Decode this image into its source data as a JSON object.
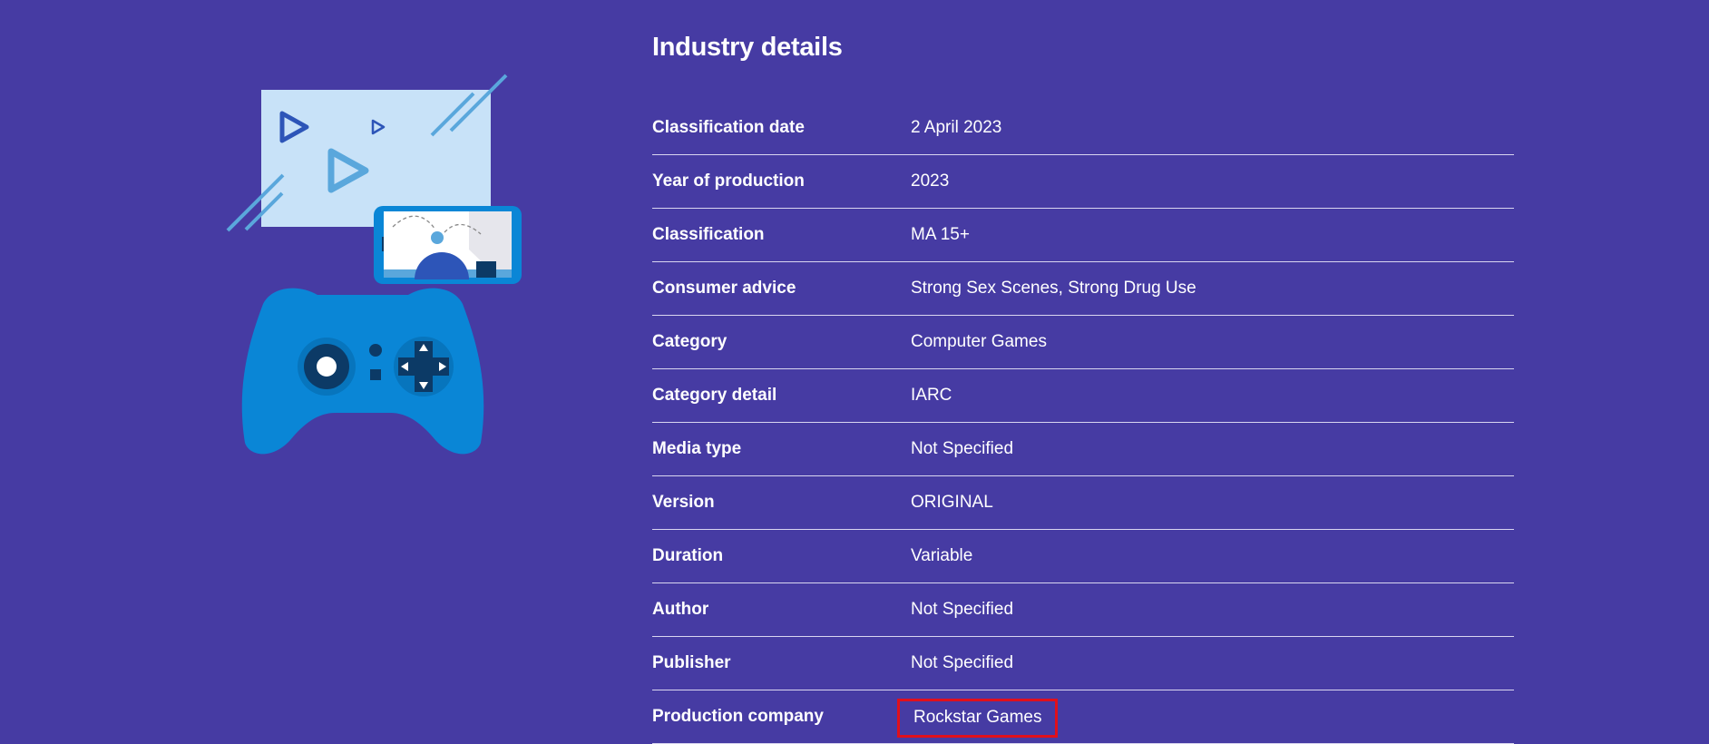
{
  "section_title": "Industry details",
  "rows": [
    {
      "label": "Classification date",
      "value": "2 April 2023"
    },
    {
      "label": "Year of production",
      "value": "2023"
    },
    {
      "label": "Classification",
      "value": "MA 15+"
    },
    {
      "label": "Consumer advice",
      "value": "Strong Sex Scenes, Strong Drug Use"
    },
    {
      "label": "Category",
      "value": "Computer Games"
    },
    {
      "label": "Category detail",
      "value": "IARC"
    },
    {
      "label": "Media type",
      "value": "Not Specified"
    },
    {
      "label": "Version",
      "value": "ORIGINAL"
    },
    {
      "label": "Duration",
      "value": "Variable"
    },
    {
      "label": "Author",
      "value": "Not Specified"
    },
    {
      "label": "Publisher",
      "value": "Not Specified"
    },
    {
      "label": "Production company",
      "value": "Rockstar Games",
      "highlighted": true
    }
  ],
  "colors": {
    "background": "#463ba3",
    "text": "#ffffff",
    "divider": "#d9d6f0",
    "highlight_border": "#e0101c",
    "illustration_light": "#c8e2f8",
    "illustration_blue": "#0a86d6",
    "illustration_dark": "#0c3a66"
  },
  "icons": [
    "video-screen-illustration",
    "phone-game-illustration",
    "game-controller-illustration"
  ]
}
